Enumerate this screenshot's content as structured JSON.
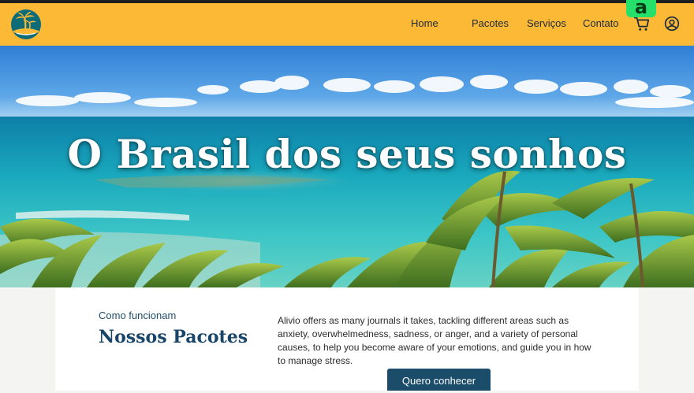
{
  "header": {
    "logo_icon": "palm-island-logo-icon",
    "nav": {
      "home": "Home",
      "packages": "Pacotes",
      "services": "Serviços",
      "contact": "Contato"
    },
    "cart_icon": "shopping-cart-icon",
    "user_icon": "user-circle-icon",
    "overlay_badge": "a"
  },
  "hero": {
    "title": "O Brasil dos seus sonhos",
    "image": "tropical-beach-palm-trees"
  },
  "packages_section": {
    "eyebrow": "Como funcionam",
    "title": "Nossos Pacotes",
    "description": "Alivio offers as many journals it takes, tackling different areas such as anxiety, overwhelmedness, sadness, or anger, and a variety of personal causes, to help you become aware of your emotions, and guide you in how to manage stress.",
    "cta": "Quero conhecer"
  },
  "colors": {
    "navbar": "#fbb936",
    "primary": "#1b4d6b",
    "title_text": "#17466a",
    "badge": "#25e06a"
  }
}
